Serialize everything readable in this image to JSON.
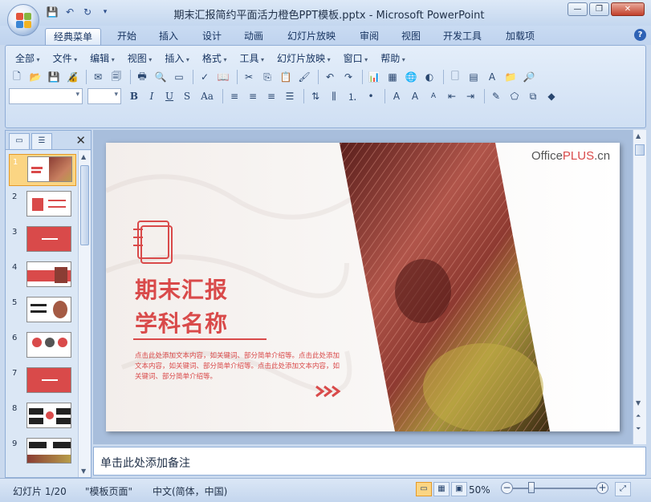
{
  "window": {
    "title": "期末汇报简约平面活力橙色PPT模板.pptx - Microsoft PowerPoint",
    "minimize_label": "—",
    "restore_label": "❐",
    "close_label": "✕"
  },
  "ribbon_tabs": [
    "经典菜单",
    "开始",
    "插入",
    "设计",
    "动画",
    "幻灯片放映",
    "审阅",
    "视图",
    "开发工具",
    "加载项"
  ],
  "menus": [
    "全部",
    "文件",
    "编辑",
    "视图",
    "插入",
    "格式",
    "工具",
    "幻灯片放映",
    "窗口",
    "帮助"
  ],
  "format_buttons": [
    "B",
    "I",
    "U",
    "S",
    "Aa"
  ],
  "slides_panel": {
    "slide_numbers": [
      "1",
      "2",
      "3",
      "4",
      "5",
      "6",
      "7",
      "8",
      "9"
    ],
    "selected": "1"
  },
  "slide": {
    "brand_prefix": "Office",
    "brand_highlight": "PLUS",
    "brand_suffix": ".cn",
    "title_line1": "期末汇报",
    "title_line2": "学科名称",
    "body": "点击此处添加文本内容，如关键词、部分简单介绍等。点击此处添加文本内容，如关键词、部分简单介绍等。点击此处添加文本内容，如关键词、部分简单介绍等。",
    "accent_color": "#d94a4a"
  },
  "notes_placeholder": "单击此处添加备注",
  "status": {
    "slide_info": "幻灯片 1/20",
    "theme": "\"模板页面\"",
    "language": "中文(简体，中国)",
    "zoom": "50%"
  }
}
